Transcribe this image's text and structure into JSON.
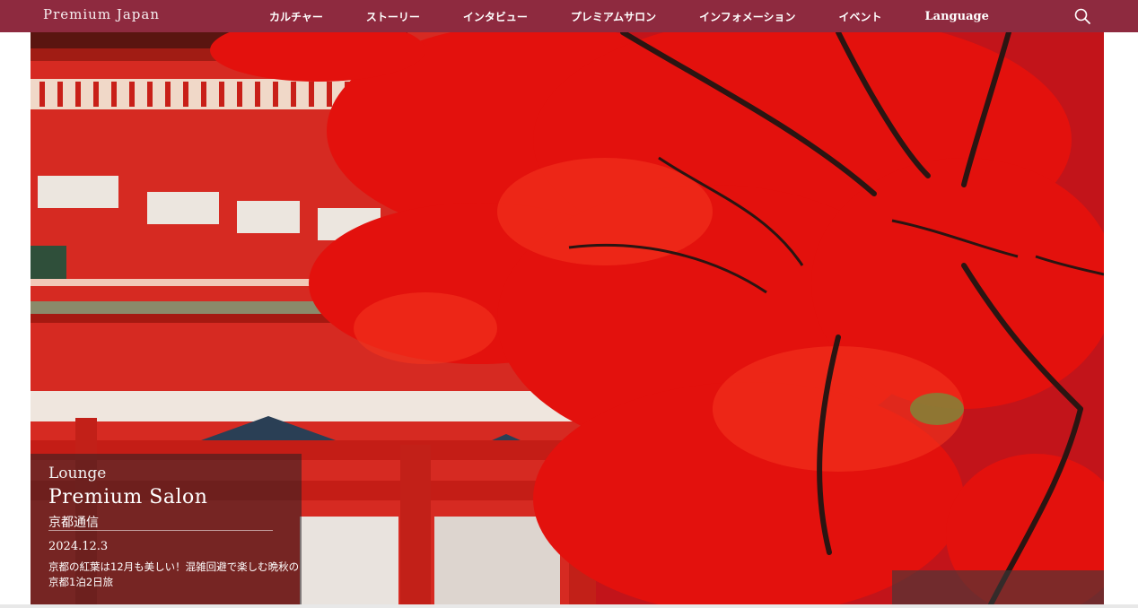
{
  "header": {
    "logo": "Premium Japan",
    "nav": [
      {
        "label": "カルチャー"
      },
      {
        "label": "ストーリー"
      },
      {
        "label": "インタビュー"
      },
      {
        "label": "プレミアムサロン"
      },
      {
        "label": "インフォメーション"
      },
      {
        "label": "イベント"
      },
      {
        "label": "Language"
      }
    ],
    "search_icon": "search-icon"
  },
  "hero": {
    "caption": {
      "kicker": "Lounge",
      "title": "Premium Salon",
      "subtitle": "京都通信",
      "date": "2024.12.3",
      "description": "京都の紅葉は12月も美しい！混雑回避で楽しむ晩秋の京都1泊2日旅"
    }
  },
  "colors": {
    "header_bg": "#8e2a3f",
    "temple_red": "#d9271e",
    "maple_red": "#e10f0c"
  }
}
